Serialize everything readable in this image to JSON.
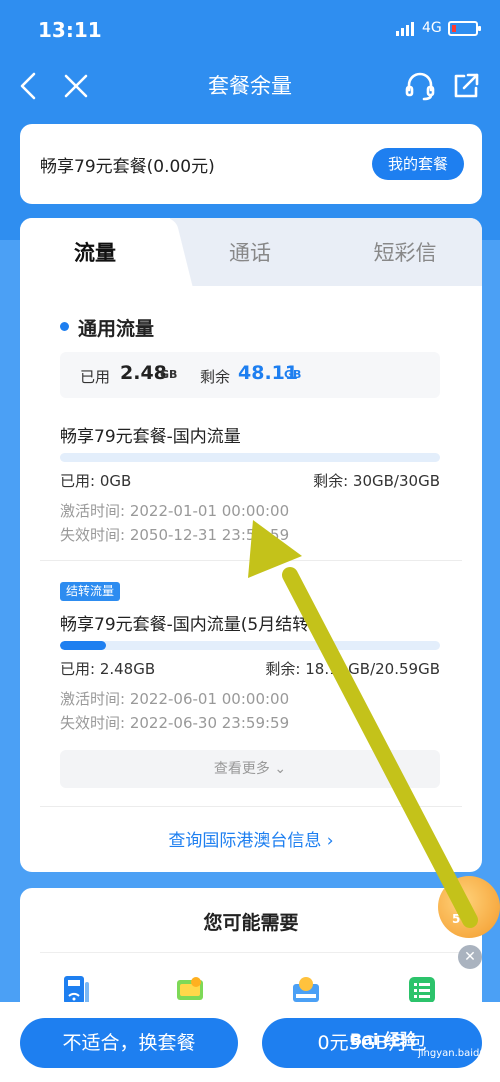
{
  "status": {
    "time": "13:11",
    "network": "4G"
  },
  "nav": {
    "title": "套餐余量"
  },
  "package": {
    "name": "畅享79元套餐(0.00元)",
    "button": "我的套餐"
  },
  "tabs": [
    "流量",
    "通话",
    "短彩信"
  ],
  "section": {
    "title": "通用流量",
    "used_label": "已用",
    "used_value": "2.48",
    "used_unit": "GB",
    "remain_label": "剩余",
    "remain_value": "48.11",
    "remain_unit": "GB"
  },
  "items": [
    {
      "name": "畅享79元套餐-国内流量",
      "used": "已用: 0GB",
      "remain": "剩余: 30GB/30GB",
      "activate": "激活时间: 2022-01-01 00:00:00",
      "expire": "失效时间: 2050-12-31 23:59:59",
      "progress": 0
    },
    {
      "badge": "结转流量",
      "name": "畅享79元套餐-国内流量(5月结转)",
      "used": "已用: 2.48GB",
      "remain": "剩余: 18.11GB/20.59GB",
      "activate": "激活时间: 2022-06-01 00:00:00",
      "expire": "失效时间: 2022-06-30 23:59:59",
      "progress": 0.12
    }
  ],
  "more": "查看更多",
  "intl": "查询国际港澳台信息",
  "recommend": {
    "title": "您可能需要"
  },
  "float": {
    "label": "5G"
  },
  "bottom": {
    "left": "不适合，换套餐",
    "right": "0元5GB月包"
  },
  "watermark": {
    "brand": "Bai 经验",
    "site": "jingyan.baidu.com"
  },
  "colors": {
    "primary": "#1e7ff0",
    "arrow": "#c4c21a"
  }
}
